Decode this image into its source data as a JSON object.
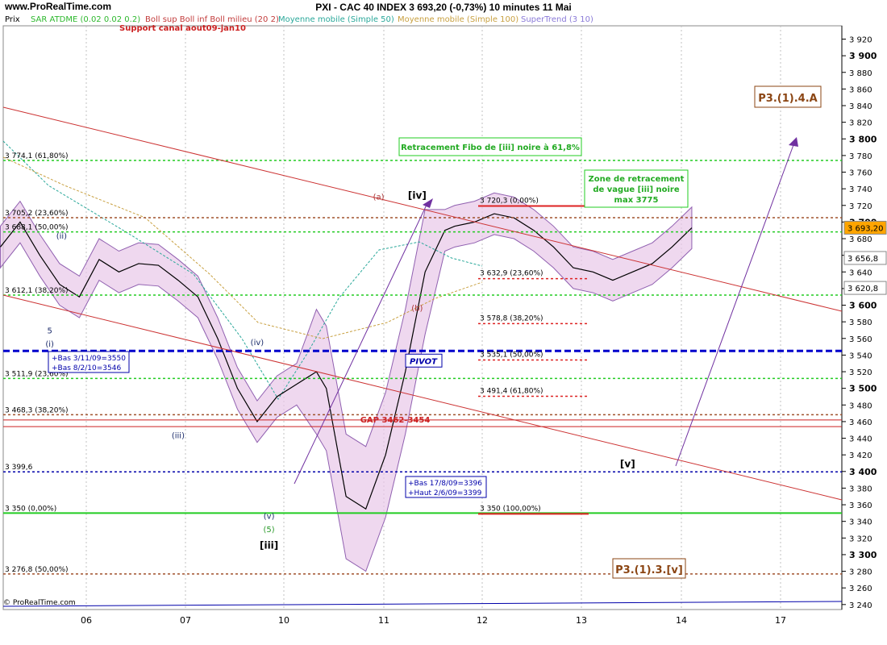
{
  "header": {
    "logo": "www.ProRealTime.com",
    "title": "PXI - CAC 40 INDEX     3 693,20 (-0,73%)     10 minutes  11 Mai",
    "footer": "© ProRealTime.com"
  },
  "indicator_legend": [
    {
      "text": "Prix",
      "color": "#000000"
    },
    {
      "text": "SAR ATDME (0.02 0.02 0.2)",
      "color": "#2db82d"
    },
    {
      "text": "Boll sup Boll inf Boll milieu (20 2)",
      "color": "#c23b3b"
    },
    {
      "text": "Moyenne mobile (Simple 50)",
      "color": "#2aa89a"
    },
    {
      "text": "Moyenne mobile (Simple 100)",
      "color": "#c8a040"
    },
    {
      "text": "SuperTrend (3 10)",
      "color": "#8a7ad8"
    }
  ],
  "chart_data": {
    "type": "line",
    "title": "PXI - CAC 40 INDEX 3 693,20 (-0,73%) 10 minutes 11 Mai",
    "xlabel": "",
    "ylabel": "",
    "x_ticks": [
      "06",
      "07",
      "10",
      "11",
      "12",
      "13",
      "14",
      "17"
    ],
    "ylim": [
      3234,
      3936
    ],
    "y_ticks": [
      3240,
      3260,
      3280,
      3300,
      3320,
      3340,
      3360,
      3380,
      3400,
      3420,
      3440,
      3460,
      3480,
      3500,
      3520,
      3540,
      3560,
      3580,
      3600,
      3620,
      3640,
      3660,
      3680,
      3700,
      3720,
      3740,
      3760,
      3780,
      3800,
      3820,
      3840,
      3860,
      3880,
      3900,
      3920
    ],
    "y_tick_labels": [
      "3 240",
      "3 260",
      "3 280",
      "3 300",
      "3 320",
      "3 340",
      "3 360",
      "3 380",
      "3 400",
      "3 420",
      "3 440",
      "3 460",
      "3 480",
      "3 500",
      "3 520",
      "3 540",
      "3 560",
      "3 580",
      "3 600",
      "3 620",
      "3 640",
      "3 660",
      "3 680",
      "3 700",
      "3 720",
      "3 740",
      "3 760",
      "3 780",
      "3 800",
      "3 820",
      "3 840",
      "3 860",
      "3 880",
      "3 900",
      "3 920"
    ],
    "y_bold_ticks": [
      3300,
      3400,
      3500,
      3600,
      3700,
      3800,
      3900
    ],
    "price_series": {
      "name": "Prix",
      "x": [
        0,
        0.2,
        0.4,
        0.6,
        0.8,
        1.0,
        1.2,
        1.4,
        1.6,
        1.8,
        2.0,
        2.2,
        2.4,
        2.6,
        2.8,
        3.0,
        3.2,
        3.3,
        3.5,
        3.7,
        3.9,
        4.1,
        4.3,
        4.5,
        4.6,
        4.8,
        5.0,
        5.2,
        5.4,
        5.6,
        5.8,
        6.0,
        6.2,
        6.4,
        6.6,
        6.8,
        7.0
      ],
      "close": [
        3670,
        3700,
        3660,
        3625,
        3610,
        3655,
        3640,
        3650,
        3648,
        3630,
        3610,
        3560,
        3500,
        3460,
        3490,
        3505,
        3520,
        3500,
        3370,
        3355,
        3420,
        3520,
        3640,
        3690,
        3695,
        3700,
        3710,
        3705,
        3690,
        3670,
        3645,
        3640,
        3630,
        3640,
        3650,
        3670,
        3693
      ]
    },
    "horizontal_levels": [
      {
        "label": "3 774,1 (61,80%)",
        "value": 3774.1,
        "color": "#22cc22",
        "style": "dotted"
      },
      {
        "label": "3 705,2 (23,60%)",
        "value": 3705.2,
        "color": "#a0522d",
        "style": "dotted"
      },
      {
        "label": "3 688,1 (50,00%)",
        "value": 3688.1,
        "color": "#22cc22",
        "style": "dotted"
      },
      {
        "label": "3 612,1 (38,20%)",
        "value": 3612.1,
        "color": "#22cc22",
        "style": "dotted"
      },
      {
        "label": "3 511,9 (23,60%)",
        "value": 3511.9,
        "color": "#22cc22",
        "style": "dotted"
      },
      {
        "label": "3 468,3 (38,20%)",
        "value": 3468.3,
        "color": "#a0522d",
        "style": "dotted"
      },
      {
        "label": "3 399,6",
        "value": 3399.6,
        "color": "#0000aa",
        "style": "dotted"
      },
      {
        "label": "3 350 (0,00%)",
        "value": 3350,
        "color": "#22cc22",
        "style": "solid"
      },
      {
        "label": "3 276,8 (50,00%)",
        "value": 3276.8,
        "color": "#a0522d",
        "style": "dotted"
      }
    ],
    "pivot_level": {
      "label": "PIVOT",
      "value": 3545
    },
    "gap": {
      "label": "GAP 3462-3454",
      "values": [
        3462,
        3454
      ]
    },
    "right_levels": [
      {
        "label": "3 720,3 (0,00%)",
        "value": 3720.3
      },
      {
        "label": "3 632,9 (23,60%)",
        "value": 3632.9
      },
      {
        "label": "3 578,8 (38,20%)",
        "value": 3578.8
      },
      {
        "label": "3 535,1 (50,00%)",
        "value": 3535.1
      },
      {
        "label": "3 491,4 (61,80%)",
        "value": 3491.4
      },
      {
        "label": "3 350 (100,00%)",
        "value": 3350
      }
    ],
    "price_tags": [
      {
        "label": "3 693,20",
        "value": 3693.2,
        "bg": "#ffa500"
      },
      {
        "label": "3 656,8",
        "value": 3656.8,
        "bg": "#ffffff"
      },
      {
        "label": "3 620,8",
        "value": 3620.8,
        "bg": "#ffffff"
      }
    ],
    "wave_labels": [
      {
        "text": "(ii)",
        "x": 0.62,
        "y": 3680
      },
      {
        "text": "5",
        "x": 0.5,
        "y": 3566
      },
      {
        "text": "(i)",
        "x": 0.5,
        "y": 3550
      },
      {
        "text": "(iv)",
        "x": 2.6,
        "y": 3552
      },
      {
        "text": "(iii)",
        "x": 1.8,
        "y": 3440
      },
      {
        "text": "(v)",
        "x": 2.72,
        "y": 3343
      },
      {
        "text": "(5)",
        "x": 2.72,
        "y": 3327
      },
      {
        "text": "[iii]",
        "x": 2.72,
        "y": 3307
      },
      {
        "text": "(a)",
        "x": 3.83,
        "y": 3727
      },
      {
        "text": "[iv]",
        "x": 4.22,
        "y": 3728
      },
      {
        "text": "(b)",
        "x": 4.22,
        "y": 3593
      },
      {
        "text": "[v]",
        "x": 6.35,
        "y": 3405
      }
    ],
    "annotations": [
      {
        "text": "Support canal aout09-jan10"
      },
      {
        "text": "Retracement Fibo de [iii] noire à 61,8%"
      },
      {
        "text": "Zone de retracement"
      },
      {
        "text": "de vague [iii] noire"
      },
      {
        "text": "max 3775"
      },
      {
        "text": "+Bas 3/11/09=3550"
      },
      {
        "text": "+Bas 8/2/10=3546"
      },
      {
        "text": "+Bas 17/8/09=3396"
      },
      {
        "text": "+Haut 2/6/09=3399"
      },
      {
        "text": "P3.(1).4.A"
      },
      {
        "text": "P3.(1).3.[v]"
      }
    ]
  }
}
